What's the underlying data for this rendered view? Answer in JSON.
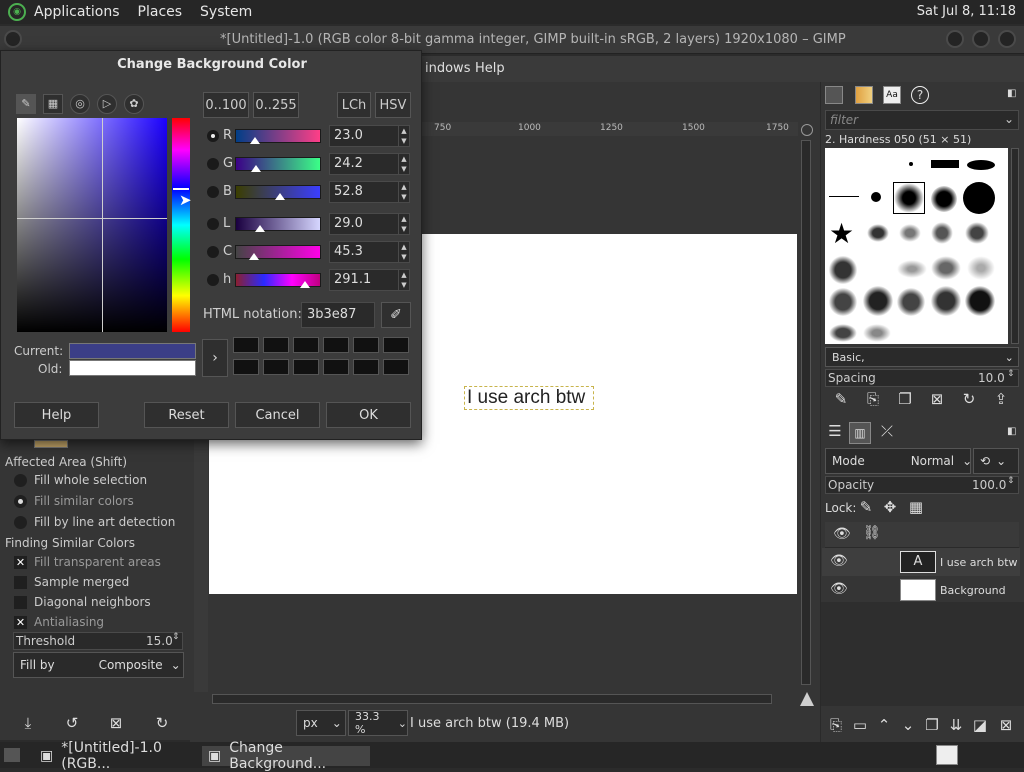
{
  "topbar": {
    "menus": [
      "Applications",
      "Places",
      "System"
    ],
    "clock": "Sat Jul  8, 11:18"
  },
  "window": {
    "title": "*[Untitled]-1.0 (RGB color 8-bit gamma integer, GIMP built-in sRGB, 2 layers) 1920x1080 – GIMP"
  },
  "menubar": {
    "items": [
      "indows",
      "Help"
    ]
  },
  "ruler": {
    "ticks": [
      "750",
      "1000",
      "1250",
      "1500",
      "1750"
    ]
  },
  "canvas": {
    "text_layer": "I use arch btw"
  },
  "status": {
    "unit": "px",
    "zoom": "33.3 %",
    "info": "I use arch btw (19.4 MB)"
  },
  "tool_options": {
    "affected_area": "Affected Area  (Shift)",
    "fill_whole": "Fill whole selection",
    "fill_similar": "Fill similar colors",
    "fill_lineart": "Fill by line art detection",
    "finding_similar": "Finding Similar Colors",
    "fill_transparent": "Fill transparent areas",
    "sample_merged": "Sample merged",
    "diagonal": "Diagonal neighbors",
    "antialiasing": "Antialiasing",
    "threshold_label": "Threshold",
    "threshold_value": "15.0",
    "fillby_label": "Fill by",
    "fillby_value": "Composite"
  },
  "brushes": {
    "filter_placeholder": "filter",
    "current": "2. Hardness 050 (51 × 51)",
    "preset": "Basic,",
    "spacing_label": "Spacing",
    "spacing_value": "10.0"
  },
  "layers": {
    "mode_label": "Mode",
    "mode_value": "Normal",
    "opacity_label": "Opacity",
    "opacity_value": "100.0",
    "lock_label": "Lock:",
    "items": [
      {
        "name": "I use arch btw"
      },
      {
        "name": "Background"
      }
    ]
  },
  "dialog": {
    "title": "Change Background Color",
    "range_buttons": [
      "0..100",
      "0..255"
    ],
    "model_buttons": [
      "LCh",
      "HSV"
    ],
    "channels": [
      {
        "label": "R",
        "value": "23.0",
        "fraction": 0.23
      },
      {
        "label": "G",
        "value": "24.2",
        "fraction": 0.242
      },
      {
        "label": "B",
        "value": "52.8",
        "fraction": 0.528
      },
      {
        "label": "L",
        "value": "29.0",
        "fraction": 0.29
      },
      {
        "label": "C",
        "value": "45.3",
        "fraction": 0.226
      },
      {
        "label": "h",
        "value": "291.1",
        "fraction": 0.809
      }
    ],
    "html_notation_label": "HTML notation:",
    "html_notation_value": "3b3e87",
    "current_label": "Current:",
    "old_label": "Old:",
    "current_color": "#3b3e87",
    "old_color": "#ffffff",
    "buttons": {
      "help": "Help",
      "reset": "Reset",
      "cancel": "Cancel",
      "ok": "OK"
    }
  },
  "taskbar": {
    "tasks": [
      "*[Untitled]-1.0 (RGB...",
      "Change Background..."
    ]
  }
}
